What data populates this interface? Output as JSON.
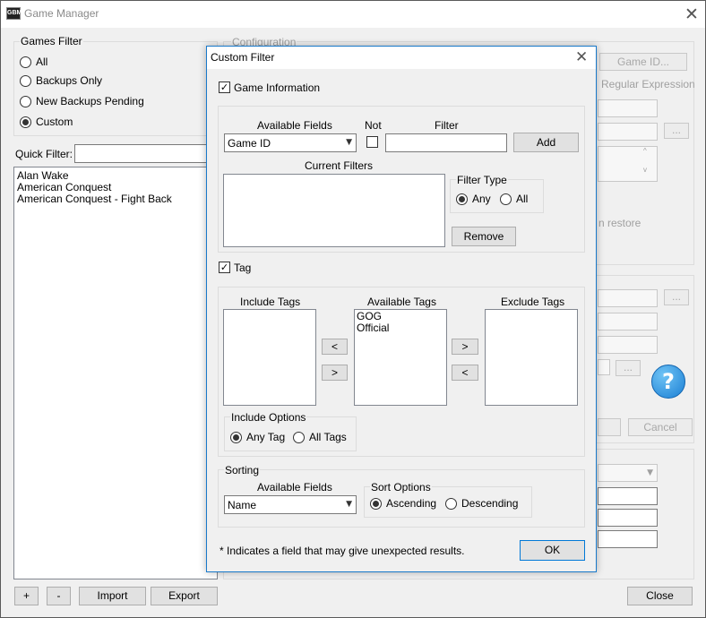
{
  "window": {
    "title": "Game Manager",
    "icon_text": "GBM",
    "close_glyph": "✕"
  },
  "games_filter": {
    "legend": "Games Filter",
    "options": [
      {
        "label": "All",
        "selected": false
      },
      {
        "label": "Backups Only",
        "selected": false
      },
      {
        "label": "New Backups Pending",
        "selected": false
      },
      {
        "label": "Custom",
        "selected": true
      }
    ]
  },
  "quick_filter": {
    "label": "Quick Filter:",
    "value": ""
  },
  "games": [
    "Alan Wake",
    "American Conquest",
    "American Conquest - Fight Back"
  ],
  "bottom_buttons": {
    "add": "+",
    "remove": "-",
    "import": "Import",
    "export": "Export",
    "close": "Close"
  },
  "background": {
    "configuration_legend": "Configuration",
    "game_id_button": "Game ID...",
    "regular_expression": "Regular Expression",
    "browse_ellipsis": "...",
    "restore_text": "n restore",
    "cancel_button": "Cancel",
    "help_glyph": "?"
  },
  "dialog": {
    "title": "Custom Filter",
    "close_glyph": "✕",
    "game_information": {
      "label": "Game Information",
      "checked": true
    },
    "available_fields_label": "Available Fields",
    "not_label": "Not",
    "not_checked": false,
    "filter_label": "Filter",
    "field_selected": "Game ID",
    "filter_value": "",
    "add_button": "Add",
    "current_filters_label": "Current Filters",
    "current_filters": [],
    "filter_type": {
      "legend": "Filter Type",
      "options": [
        {
          "label": "Any",
          "selected": true
        },
        {
          "label": "All",
          "selected": false
        }
      ]
    },
    "remove_button": "Remove",
    "tag": {
      "label": "Tag",
      "checked": true
    },
    "include_tags_label": "Include Tags",
    "available_tags_label": "Available Tags",
    "exclude_tags_label": "Exclude Tags",
    "include_tags": [],
    "available_tags": [
      "GOG",
      "Official"
    ],
    "exclude_tags": [],
    "move_left": "<",
    "move_right": ">",
    "include_options": {
      "legend": "Include Options",
      "options": [
        {
          "label": "Any Tag",
          "selected": true
        },
        {
          "label": "All Tags",
          "selected": false
        }
      ]
    },
    "sorting": {
      "legend": "Sorting",
      "available_fields_label": "Available Fields",
      "field_selected": "Name",
      "sort_options": {
        "legend": "Sort Options",
        "options": [
          {
            "label": "Ascending",
            "selected": true
          },
          {
            "label": "Descending",
            "selected": false
          }
        ]
      }
    },
    "footnote": "* Indicates a field that may give unexpected results.",
    "ok_button": "OK"
  },
  "icons": {
    "dropdown": "chevron-down-icon",
    "close": "close-icon",
    "help": "help-icon",
    "app": "app-icon"
  }
}
